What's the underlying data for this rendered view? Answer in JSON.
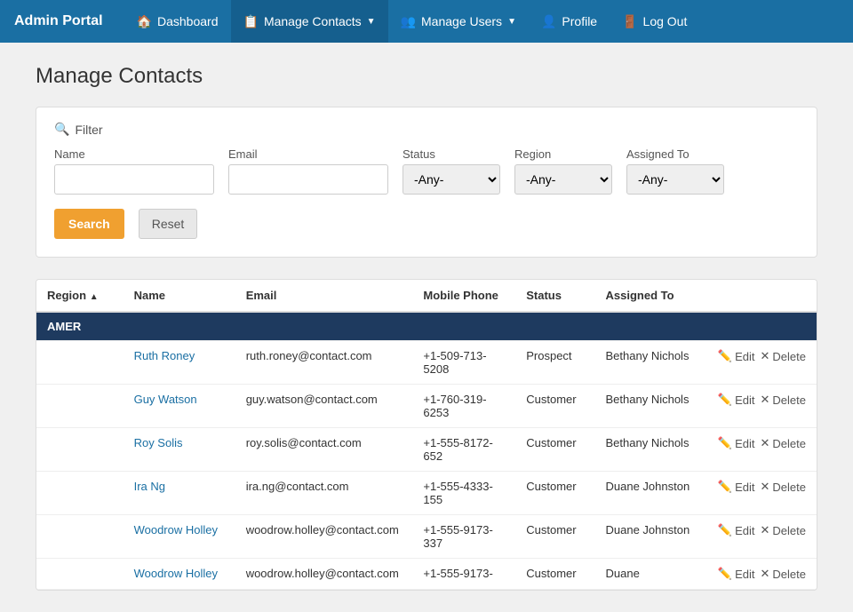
{
  "brand": "Admin Portal",
  "nav": {
    "items": [
      {
        "id": "dashboard",
        "label": "Dashboard",
        "icon": "🏠",
        "active": false,
        "has_dropdown": false
      },
      {
        "id": "manage-contacts",
        "label": "Manage Contacts",
        "icon": "📋",
        "active": true,
        "has_dropdown": true
      },
      {
        "id": "manage-users",
        "label": "Manage Users",
        "icon": "👥",
        "active": false,
        "has_dropdown": true
      },
      {
        "id": "profile",
        "label": "Profile",
        "icon": "👤",
        "active": false,
        "has_dropdown": false
      },
      {
        "id": "logout",
        "label": "Log Out",
        "icon": "🚪",
        "active": false,
        "has_dropdown": false
      }
    ]
  },
  "page": {
    "title": "Manage Contacts"
  },
  "filter": {
    "header": "Filter",
    "fields": {
      "name_label": "Name",
      "email_label": "Email",
      "status_label": "Status",
      "region_label": "Region",
      "assigned_label": "Assigned To",
      "status_default": "-Any-",
      "region_default": "-Any-",
      "assigned_default": "-Any-"
    },
    "search_btn": "Search",
    "reset_btn": "Reset"
  },
  "table": {
    "columns": [
      {
        "id": "region",
        "label": "Region"
      },
      {
        "id": "name",
        "label": "Name"
      },
      {
        "id": "email",
        "label": "Email"
      },
      {
        "id": "phone",
        "label": "Mobile Phone"
      },
      {
        "id": "status",
        "label": "Status"
      },
      {
        "id": "assigned",
        "label": "Assigned To"
      },
      {
        "id": "actions",
        "label": ""
      }
    ],
    "groups": [
      {
        "region": "AMER",
        "contacts": [
          {
            "name": "Ruth Roney",
            "email": "ruth.roney@contact.com",
            "phone": "+1-509-713-5208",
            "status": "Prospect",
            "assigned": "Bethany Nichols"
          },
          {
            "name": "Guy Watson",
            "email": "guy.watson@contact.com",
            "phone": "+1-760-319-6253",
            "status": "Customer",
            "assigned": "Bethany Nichols"
          },
          {
            "name": "Roy Solis",
            "email": "roy.solis@contact.com",
            "phone": "+1-555-8172-652",
            "status": "Customer",
            "assigned": "Bethany Nichols"
          },
          {
            "name": "Ira Ng",
            "email": "ira.ng@contact.com",
            "phone": "+1-555-4333-155",
            "status": "Customer",
            "assigned": "Duane Johnston"
          },
          {
            "name": "Woodrow Holley",
            "email": "woodrow.holley@contact.com",
            "phone": "+1-555-9173-337",
            "status": "Customer",
            "assigned": "Duane Johnston"
          },
          {
            "name": "Woodrow Holley",
            "email": "woodrow.holley@contact.com",
            "phone": "+1-555-9173-",
            "status": "Customer",
            "assigned": "Duane"
          }
        ]
      }
    ],
    "edit_label": "Edit",
    "delete_label": "Delete"
  }
}
